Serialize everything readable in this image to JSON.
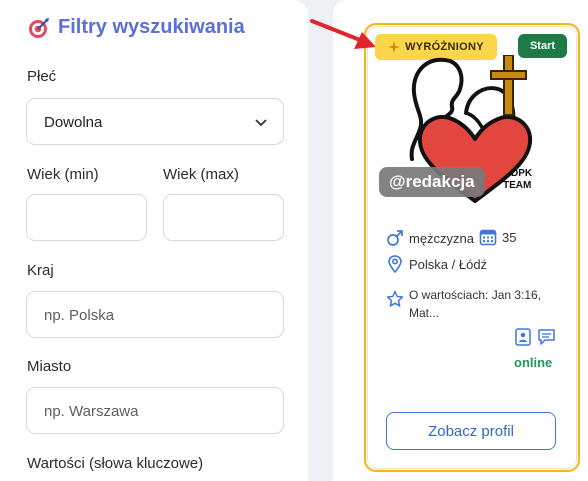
{
  "filters": {
    "title": "Filtry wyszukiwania",
    "gender_label": "Płeć",
    "gender_value": "Dowolna",
    "age_min_label": "Wiek (min)",
    "age_max_label": "Wiek (max)",
    "country_label": "Kraj",
    "country_placeholder": "np. Polska",
    "city_label": "Miasto",
    "city_placeholder": "np. Warszawa",
    "keywords_label": "Wartości (słowa kluczowe)"
  },
  "card": {
    "featured_badge": "WYRÓŻNIONY",
    "start_badge": "Start",
    "handle": "@redakcja",
    "logo_text_1": "DPK",
    "logo_text_2": "TEAM",
    "gender": "mężczyzna",
    "age": "35",
    "location": "Polska / Łódź",
    "about": "O wartościach: Jan 3:16, Mat...",
    "status": "online",
    "view_profile": "Zobacz profil"
  },
  "colors": {
    "title_blue": "#5b6fd6",
    "featured_gold": "#fbd54a",
    "card_border": "#f5b41c",
    "start_green": "#1e7a45",
    "online_green": "#25955a",
    "button_blue": "#3f78d8",
    "arrow_red": "#e0252c"
  },
  "icons": [
    "target-icon",
    "chevron-down-icon",
    "sparkle-icon",
    "male-icon",
    "calendar-icon",
    "location-pin-icon",
    "star-outline-icon",
    "id-card-icon",
    "message-icon",
    "red-arrow"
  ]
}
